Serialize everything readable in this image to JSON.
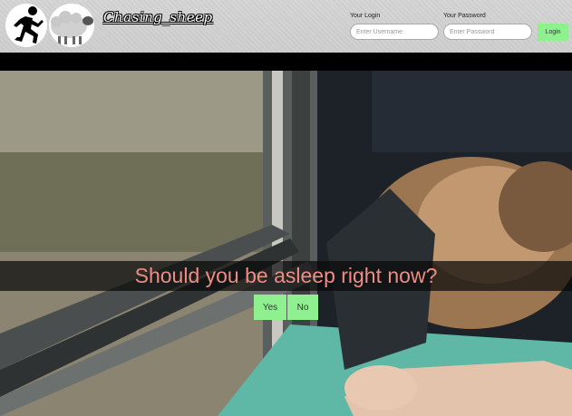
{
  "brand": {
    "name": "Chasing_sheep"
  },
  "login": {
    "login_label": "Your Login",
    "login_placeholder": "Enter Username",
    "password_label": "Your Password",
    "password_placeholder": "Enter Password",
    "button_label": "Login"
  },
  "hero": {
    "question": "Should you be asleep right now?",
    "yes_label": "Yes",
    "no_label": "No"
  },
  "colors": {
    "accent_green": "#8ff08f",
    "headline": "#f08c84"
  }
}
